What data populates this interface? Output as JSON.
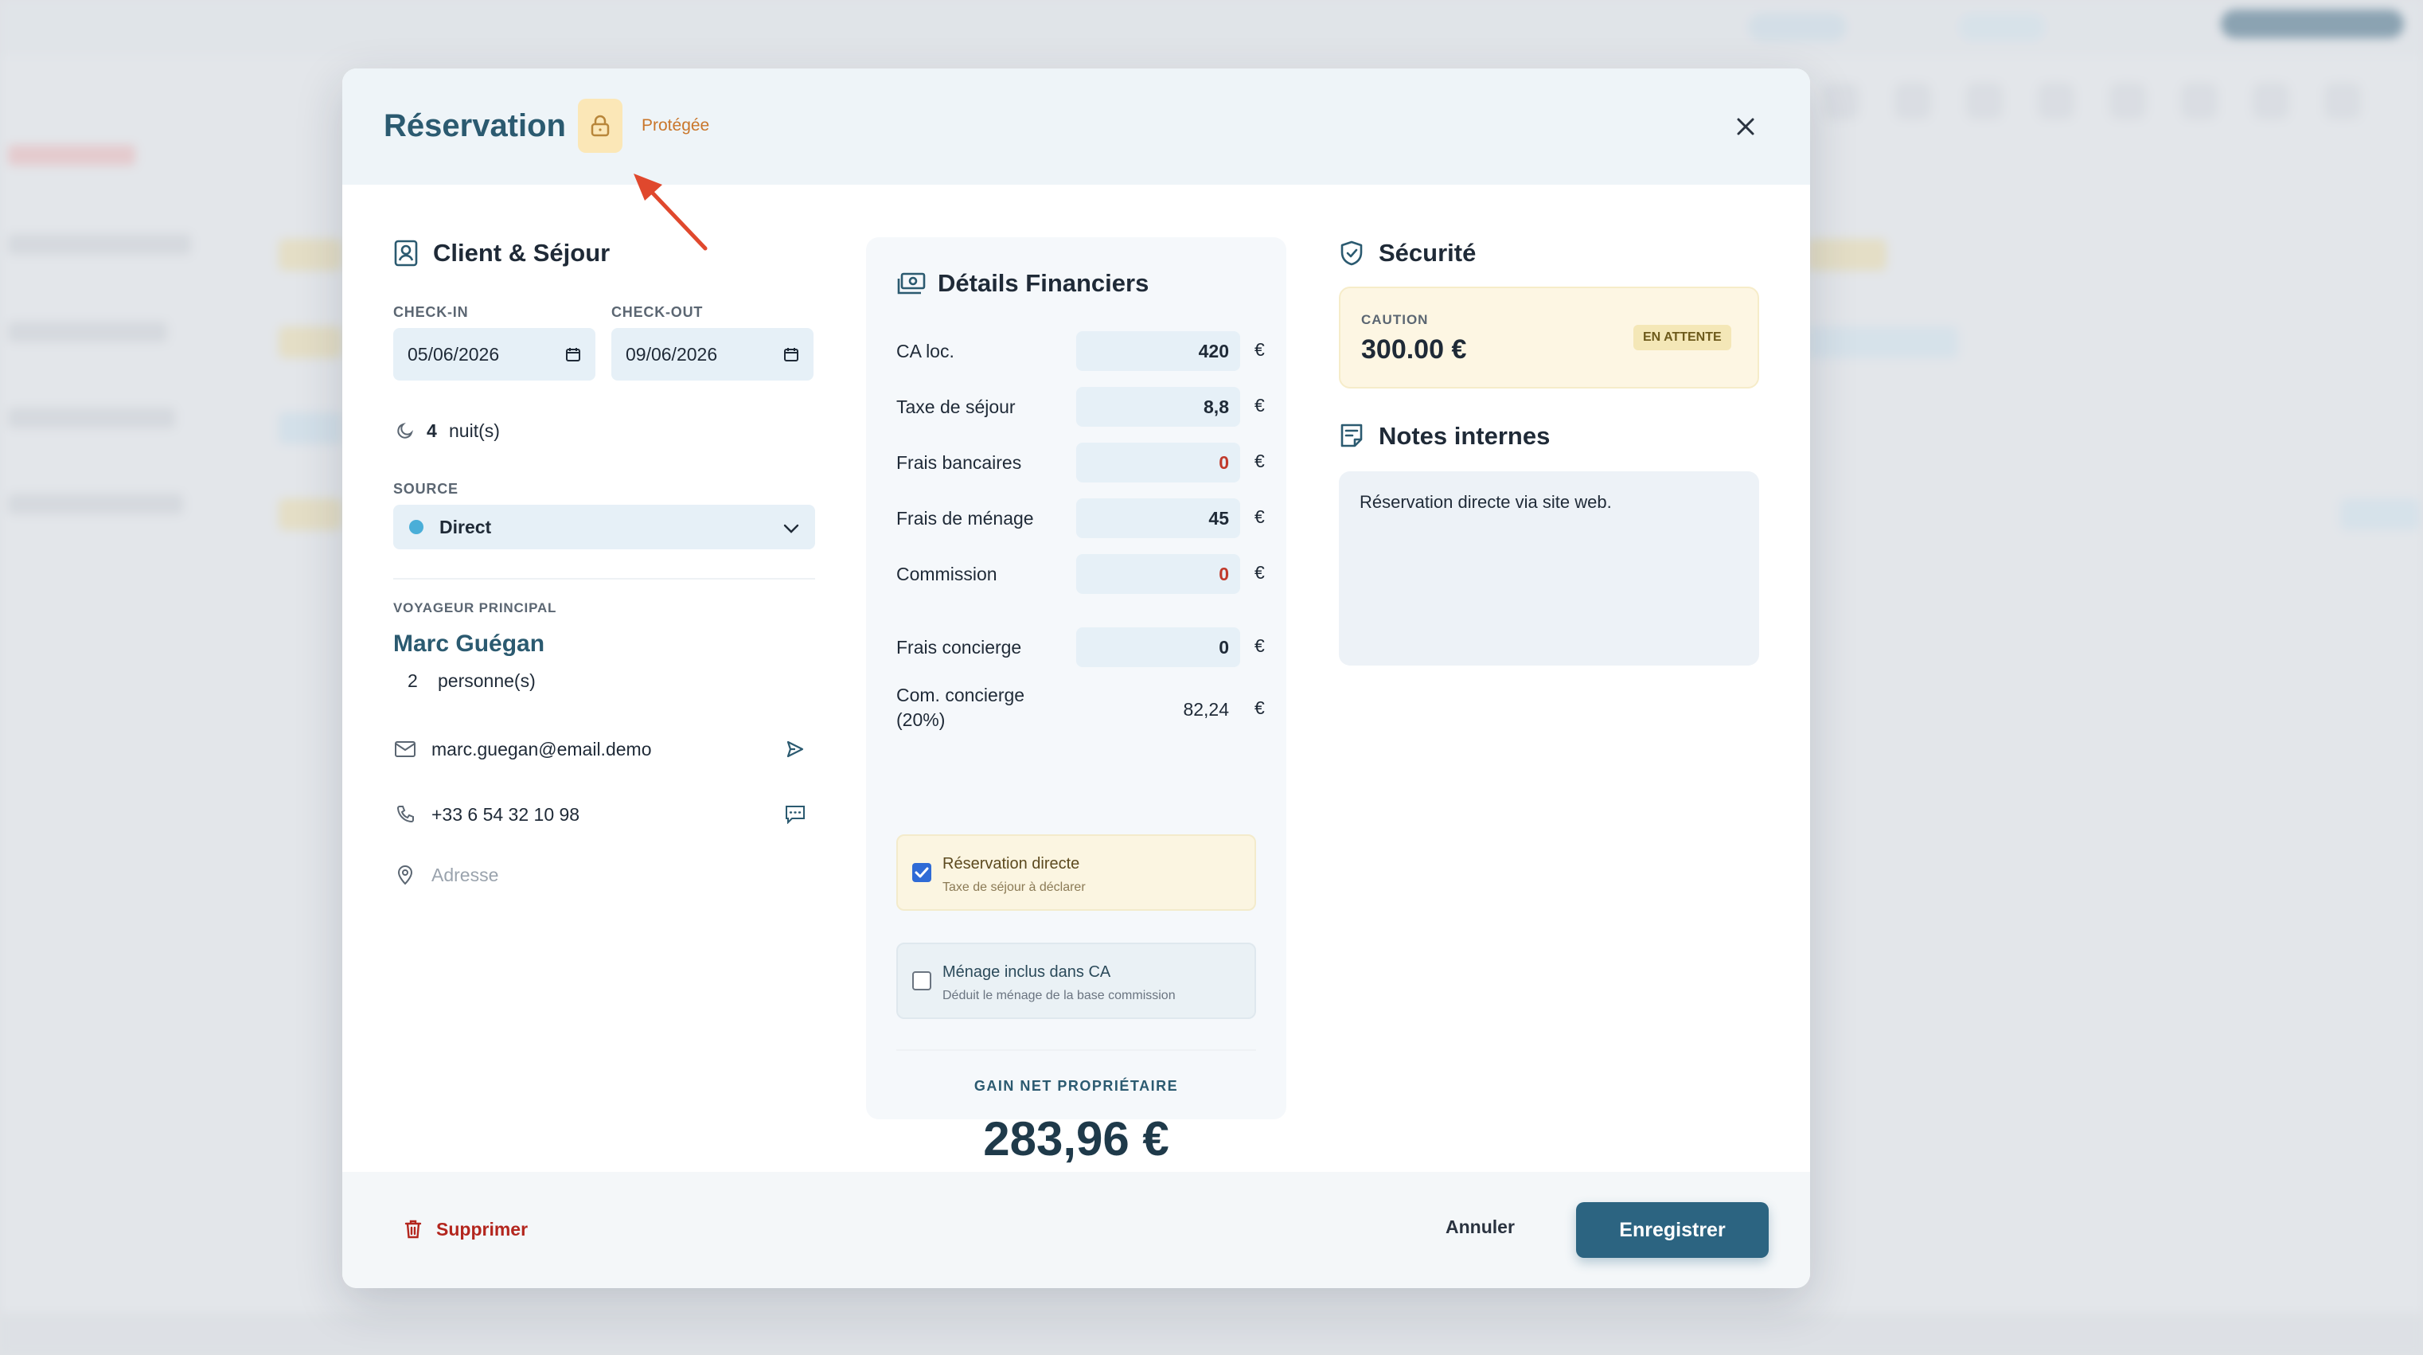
{
  "modal": {
    "title": "Réservation",
    "protected_label": "Protégée"
  },
  "client": {
    "section_title": "Client & Séjour",
    "checkin_label": "CHECK-IN",
    "checkin_value": "05/06/2026",
    "checkout_label": "CHECK-OUT",
    "checkout_value": "09/06/2026",
    "nights_count": "4",
    "nights_label": "nuit(s)",
    "source_label": "SOURCE",
    "source_value": "Direct",
    "guest_label": "VOYAGEUR PRINCIPAL",
    "guest_name": "Marc Guégan",
    "persons_count": "2",
    "persons_label": "personne(s)",
    "email": "marc.guegan@email.demo",
    "phone": "+33 6 54 32 10 98",
    "address_placeholder": "Adresse"
  },
  "finance": {
    "section_title": "Détails Financiers",
    "currency": "€",
    "rows": [
      {
        "label": "CA loc.",
        "value": "420"
      },
      {
        "label": "Taxe de séjour",
        "value": "8,8"
      },
      {
        "label": "Frais bancaires",
        "value": "0"
      },
      {
        "label": "Frais de ménage",
        "value": "45"
      },
      {
        "label": "Commission",
        "value": "0"
      },
      {
        "label": "Frais concierge",
        "value": "0"
      },
      {
        "label": "Com. concierge (20%)",
        "value": "82,24"
      }
    ],
    "direct_checkbox": {
      "title": "Réservation directe",
      "subtitle": "Taxe de séjour à déclarer",
      "checked": true
    },
    "cleaning_checkbox": {
      "title": "Ménage inclus dans CA",
      "subtitle": "Déduit le ménage de la base commission",
      "checked": false
    },
    "gain_label": "GAIN NET PROPRIÉTAIRE",
    "gain_value": "283,96 €"
  },
  "security": {
    "section_title": "Sécurité",
    "caution_label": "CAUTION",
    "caution_value": "300.00 €",
    "status_badge": "EN ATTENTE"
  },
  "notes": {
    "section_title": "Notes internes",
    "content": "Réservation directe via site web."
  },
  "footer": {
    "delete_label": "Supprimer",
    "cancel_label": "Annuler",
    "save_label": "Enregistrer"
  },
  "colors": {
    "primary": "#2c6481",
    "title": "#2b5a70",
    "danger": "#b3261e",
    "warning_badge": "#fbe7b7",
    "arrow": "#e0482d"
  }
}
